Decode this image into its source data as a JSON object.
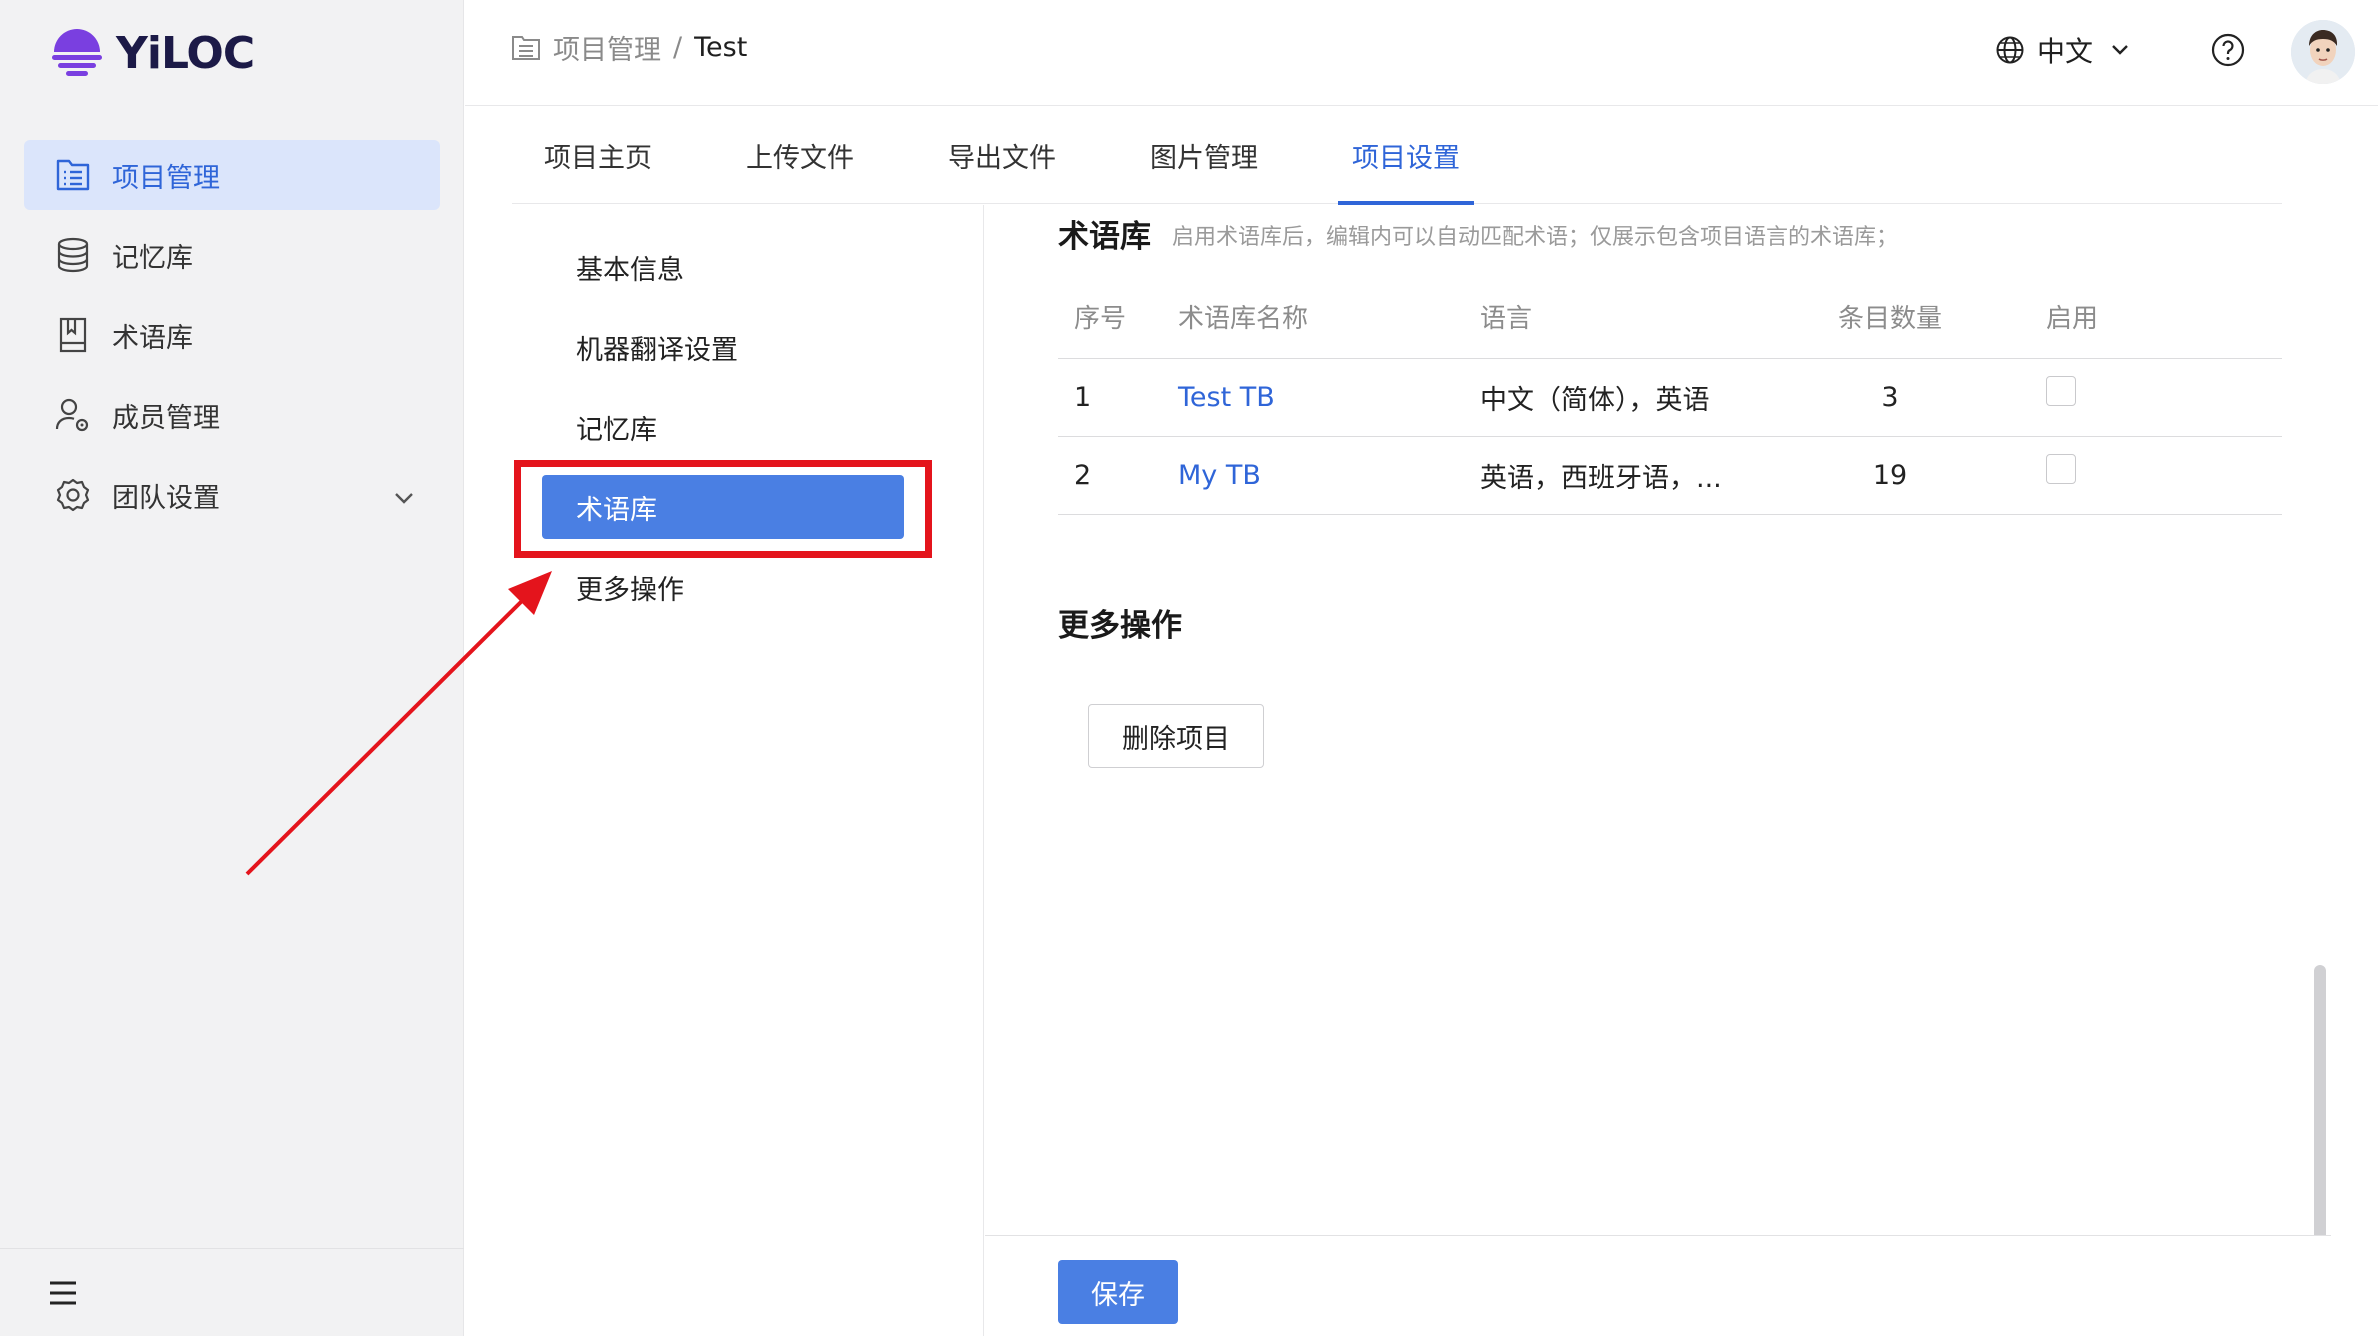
{
  "app": {
    "logo_text": "YiLOC"
  },
  "sidebar": {
    "items": [
      {
        "label": "项目管理",
        "icon": "project-list-icon",
        "active": true
      },
      {
        "label": "记忆库",
        "icon": "database-icon",
        "active": false
      },
      {
        "label": "术语库",
        "icon": "book-icon",
        "active": false
      },
      {
        "label": "成员管理",
        "icon": "user-settings-icon",
        "active": false
      },
      {
        "label": "团队设置",
        "icon": "gear-icon",
        "active": false,
        "expandable": true
      }
    ],
    "menu_toggle_icon": "hamburger-icon"
  },
  "header": {
    "breadcrumb": {
      "root": "项目管理",
      "separator": "/",
      "current": "Test"
    },
    "language": "中文",
    "help_icon": "question-circle-icon",
    "avatar_icon": "user-avatar"
  },
  "tabs": [
    {
      "label": "项目主页",
      "active": false
    },
    {
      "label": "上传文件",
      "active": false
    },
    {
      "label": "导出文件",
      "active": false
    },
    {
      "label": "图片管理",
      "active": false
    },
    {
      "label": "项目设置",
      "active": true
    }
  ],
  "settings_menu": {
    "items": [
      {
        "label": "基本信息",
        "active": false
      },
      {
        "label": "机器翻译设置",
        "active": false
      },
      {
        "label": "记忆库",
        "active": false
      },
      {
        "label": "术语库",
        "active": true
      },
      {
        "label": "更多操作",
        "active": false
      }
    ]
  },
  "termbase": {
    "title": "术语库",
    "description": "启用术语库后，编辑内可以自动匹配术语；仅展示包含项目语言的术语库；",
    "columns": [
      "序号",
      "术语库名称",
      "语言",
      "条目数量",
      "启用"
    ],
    "rows": [
      {
        "index": "1",
        "name": "Test TB",
        "languages": "中文（简体），英语",
        "count": "3",
        "enabled": false
      },
      {
        "index": "2",
        "name": "My TB",
        "languages": "英语，西班牙语，...",
        "count": "19",
        "enabled": false
      }
    ]
  },
  "more_actions": {
    "title": "更多操作",
    "delete_label": "删除项目"
  },
  "footer": {
    "save_label": "保存"
  },
  "colors": {
    "primary": "#4a7fe3",
    "link": "#2f65d8",
    "annotation": "#e4141c",
    "sidebar_bg": "#f2f2f3",
    "active_bg": "#dbe5fb"
  }
}
